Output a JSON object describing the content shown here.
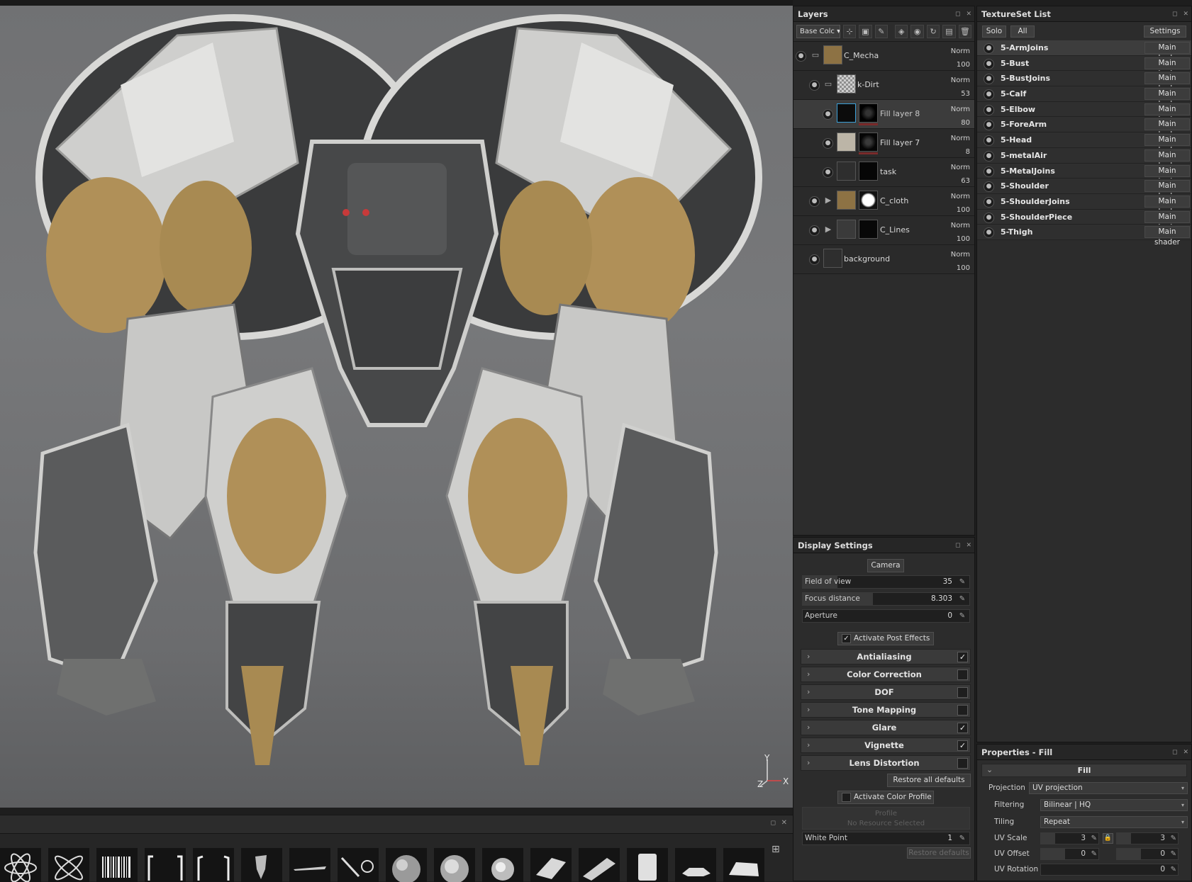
{
  "layers_panel": {
    "title": "Layers",
    "channel": "Base Colc",
    "rows": [
      {
        "name": "C_Mecha",
        "blend": "Norm",
        "opacity": "100"
      },
      {
        "name": "k-Dirt",
        "blend": "Norm",
        "opacity": "53"
      },
      {
        "name": "Fill layer 8",
        "blend": "Norm",
        "opacity": "80"
      },
      {
        "name": "Fill layer 7",
        "blend": "Norm",
        "opacity": "8"
      },
      {
        "name": "task",
        "blend": "Norm",
        "opacity": "63"
      },
      {
        "name": "C_cloth",
        "blend": "Norm",
        "opacity": "100"
      },
      {
        "name": "C_Lines",
        "blend": "Norm",
        "opacity": "100"
      },
      {
        "name": "background",
        "blend": "Norm",
        "opacity": "100"
      }
    ]
  },
  "textureset_panel": {
    "title": "TextureSet List",
    "solo_label": "Solo",
    "all_label": "All",
    "settings_label": "Settings",
    "items": [
      {
        "name": "5-ArmJoins",
        "shader": "Main shader"
      },
      {
        "name": "5-Bust",
        "shader": "Main shader"
      },
      {
        "name": "5-BustJoins",
        "shader": "Main shader"
      },
      {
        "name": "5-Calf",
        "shader": "Main shader"
      },
      {
        "name": "5-Elbow",
        "shader": "Main shader"
      },
      {
        "name": "5-ForeArm",
        "shader": "Main shader"
      },
      {
        "name": "5-Head",
        "shader": "Main shader"
      },
      {
        "name": "5-metalAir",
        "shader": "Main shader"
      },
      {
        "name": "5-MetalJoins",
        "shader": "Main shader"
      },
      {
        "name": "5-Shoulder",
        "shader": "Main shader"
      },
      {
        "name": "5-ShoulderJoins",
        "shader": "Main shader"
      },
      {
        "name": "5-ShoulderPiece",
        "shader": "Main shader"
      },
      {
        "name": "5-Thigh",
        "shader": "Main shader"
      }
    ]
  },
  "display_settings": {
    "title": "Display Settings",
    "camera_tab": "Camera",
    "fov_label": "Field of view",
    "fov_value": "35",
    "fov_fill": 0.21,
    "focus_label": "Focus distance",
    "focus_value": "8.303",
    "focus_fill": 0.42,
    "aperture_label": "Aperture",
    "aperture_value": "0",
    "aperture_fill": 0.0,
    "post_effects_label": "Activate Post Effects",
    "effects": [
      {
        "name": "Antialiasing",
        "checked": "✓"
      },
      {
        "name": "Color Correction",
        "checked": ""
      },
      {
        "name": "DOF",
        "checked": ""
      },
      {
        "name": "Tone Mapping",
        "checked": ""
      },
      {
        "name": "Glare",
        "checked": "✓"
      },
      {
        "name": "Vignette",
        "checked": "✓"
      },
      {
        "name": "Lens Distortion",
        "checked": ""
      }
    ],
    "restore_all": "Restore all defaults",
    "color_profile_label": "Activate Color Profile",
    "profile_label": "Profile",
    "no_resource": "No Resource Selected",
    "white_point_label": "White Point",
    "white_point_value": "1",
    "restore_defaults": "Restore defaults"
  },
  "properties": {
    "title": "Properties - Fill",
    "section": "Fill",
    "projection_label": "Projection",
    "projection_value": "UV projection",
    "filtering_label": "Filtering",
    "filtering_value": "Bilinear | HQ",
    "tiling_label": "Tiling",
    "tiling_value": "Repeat",
    "uv_scale_label": "UV Scale",
    "uv_scale_u": "3",
    "uv_scale_v": "3",
    "uv_offset_label": "UV Offset",
    "uv_offset_u": "0",
    "uv_offset_v": "0",
    "uv_rotation_label": "UV Rotation",
    "uv_rotation_value": "0"
  },
  "viewport": {
    "axis_y": "Y",
    "axis_z": "Z",
    "axis_x": "X"
  },
  "colors": {
    "accent_yellow": "#b8924e",
    "panel_bg": "#2c2c2c",
    "viewport_bg": "#707173"
  }
}
